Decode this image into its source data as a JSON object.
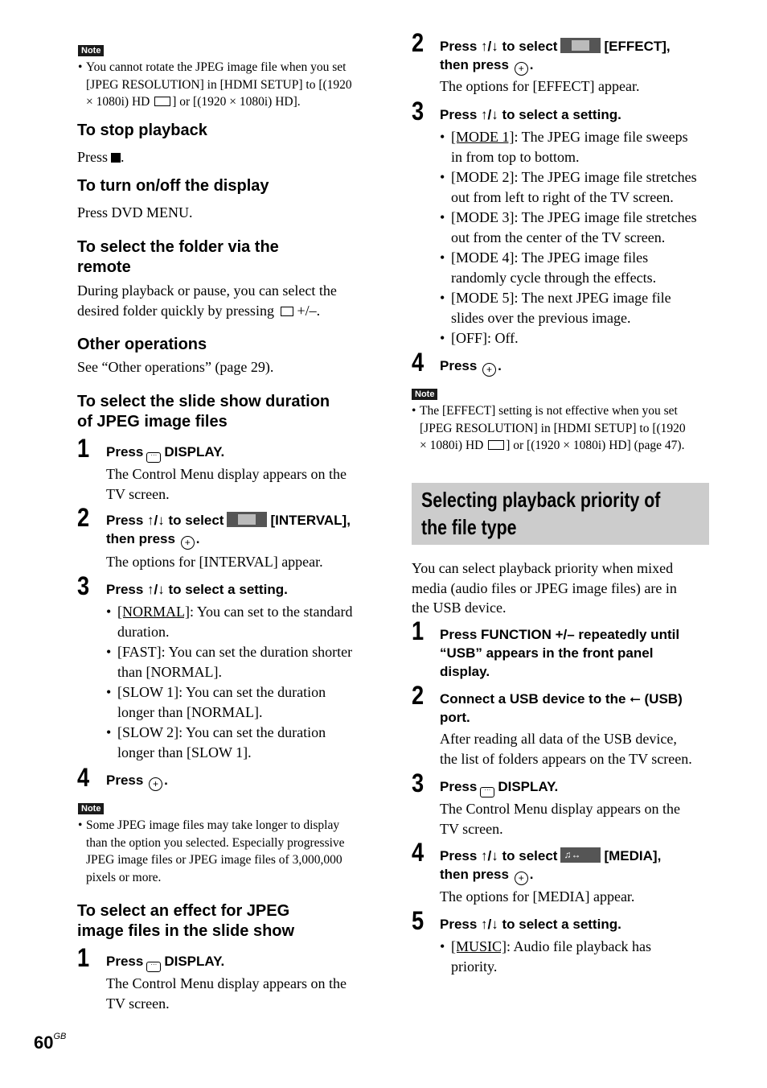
{
  "left": {
    "note1": {
      "tag": "Note",
      "bullet": "•",
      "lines": [
        "You cannot rotate the JPEG image file when you set",
        "[JPEG RESOLUTION] in [HDMI SETUP] to [(1920",
        "× 1080i) HD",
        "] or [(1920 × 1080i) HD]."
      ]
    },
    "stop": {
      "heading": "To stop playback",
      "text": "Press"
    },
    "display": {
      "heading": "To turn on/off the display",
      "text": "Press DVD MENU."
    },
    "folder": {
      "heading_lines": [
        "To select the folder via the",
        "remote"
      ],
      "lines": [
        "During playback or pause, you can select the",
        "desired folder quickly by pressing",
        "+/–."
      ]
    },
    "other": {
      "heading": "Other operations",
      "text": "See “Other operations” (page 29)."
    },
    "duration": {
      "heading_lines": [
        "To select the slide show duration",
        "of JPEG image files"
      ],
      "steps": [
        {
          "num": "1",
          "head_pre": "Press",
          "head_post": "DISPLAY.",
          "body": [
            "The Control Menu display appears on the",
            "TV screen."
          ]
        },
        {
          "num": "2",
          "head_pre": "Press ↑/↓ to select",
          "head_post": "[INTERVAL],",
          "head_line2": "then press",
          "body": [
            "The options for [INTERVAL] appear."
          ]
        },
        {
          "num": "3",
          "head": "Press ↑/↓ to select a setting.",
          "bullets": [
            {
              "u": "[NORMAL]",
              "rest": ": You can set to the standard",
              "line2": "duration."
            },
            {
              "u": "",
              "rest": "[FAST]: You can set the duration shorter",
              "line2": "than [NORMAL]."
            },
            {
              "u": "",
              "rest": "[SLOW 1]: You can set the duration",
              "line2": "longer than [NORMAL]."
            },
            {
              "u": "",
              "rest": "[SLOW 2]: You can set the duration",
              "line2": "longer than [SLOW 1]."
            }
          ]
        },
        {
          "num": "4",
          "head_pre": "Press"
        }
      ]
    },
    "note2": {
      "tag": "Note",
      "bullet": "•",
      "lines": [
        "Some JPEG image files may take longer to display",
        "than the option you selected. Especially progressive",
        "JPEG image files or JPEG image files of 3,000,000",
        "pixels or more."
      ]
    },
    "effect": {
      "heading_lines": [
        "To select an effect for JPEG",
        "image files in the slide show"
      ],
      "step1": {
        "num": "1",
        "head_pre": "Press",
        "head_post": "DISPLAY.",
        "body": [
          "The Control Menu display appears on the",
          "TV screen."
        ]
      }
    }
  },
  "right": {
    "effect_steps": [
      {
        "num": "2",
        "head_pre": "Press ↑/↓ to select",
        "head_post": "[EFFECT],",
        "head_line2": "then press",
        "body": [
          "The options for [EFFECT] appear."
        ]
      },
      {
        "num": "3",
        "head": "Press ↑/↓ to select a setting.",
        "bullets": [
          {
            "u": "[MODE 1]",
            "rest": ": The JPEG image file sweeps",
            "line2": "in from top to bottom."
          },
          {
            "u": "",
            "rest": "[MODE 2]: The JPEG image file stretches",
            "line2": "out from left to right of the TV screen."
          },
          {
            "u": "",
            "rest": "[MODE 3]: The JPEG image file stretches",
            "line2": "out from the center of the TV screen."
          },
          {
            "u": "",
            "rest": "[MODE 4]: The JPEG image files",
            "line2": "randomly cycle through the effects."
          },
          {
            "u": "",
            "rest": "[MODE 5]: The next JPEG image file",
            "line2": "slides over the previous image."
          },
          {
            "u": "",
            "rest": "[OFF]: Off.",
            "line2": ""
          }
        ]
      },
      {
        "num": "4",
        "head_pre": "Press"
      }
    ],
    "note3": {
      "tag": "Note",
      "bullet": "•",
      "lines": [
        "The [EFFECT] setting is not effective when you set",
        "[JPEG RESOLUTION] in [HDMI SETUP] to [(1920",
        "× 1080i) HD",
        "] or [(1920 × 1080i) HD] (page 47)."
      ]
    },
    "section_title_lines": [
      "Selecting playback priority of",
      "the file type"
    ],
    "intro": [
      "You can select playback priority when mixed",
      "media (audio files or JPEG image files) are in",
      "the USB device."
    ],
    "steps": [
      {
        "num": "1",
        "head_lines": [
          "Press FUNCTION +/– repeatedly until",
          "“USB” appears in the front panel",
          "display."
        ]
      },
      {
        "num": "2",
        "head_pre": "Connect a USB device to the",
        "head_post": "(USB)",
        "head_line2": "port.",
        "body": [
          "After reading all data of the USB device,",
          "the list of folders appears on the TV screen."
        ]
      },
      {
        "num": "3",
        "head_pre": "Press",
        "head_post": "DISPLAY.",
        "body": [
          "The Control Menu display appears on the",
          "TV screen."
        ]
      },
      {
        "num": "4",
        "head_pre": "Press ↑/↓ to select",
        "head_post": "[MEDIA],",
        "head_line2": "then press",
        "body": [
          "The options for [MEDIA] appear."
        ]
      },
      {
        "num": "5",
        "head": "Press ↑/↓ to select a setting.",
        "bullets": [
          {
            "u": "[MUSIC]",
            "rest": ": Audio file playback has",
            "line2": "priority."
          }
        ]
      }
    ]
  },
  "footer": {
    "page": "60",
    "suffix": "GB"
  },
  "icons": {
    "enter": "+",
    "display": "···",
    "usb": "⭠",
    "music_media": "♫↔"
  }
}
